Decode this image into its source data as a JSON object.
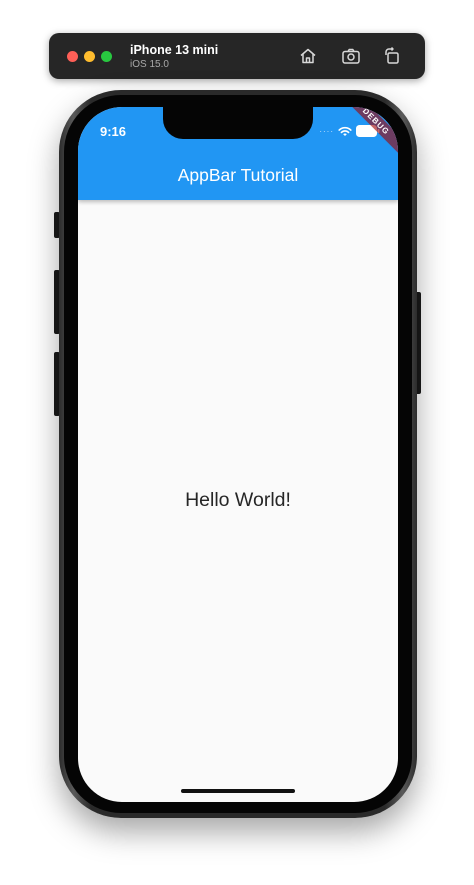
{
  "simulator": {
    "device_name": "iPhone 13 mini",
    "os_version": "iOS 15.0",
    "toolbar_icons": [
      "home-icon",
      "screenshot-icon",
      "rotate-icon"
    ]
  },
  "status_bar": {
    "time": "9:16",
    "icons": [
      "signal-dots-icon",
      "wifi-icon",
      "battery-icon"
    ]
  },
  "app_bar": {
    "title": "AppBar Tutorial",
    "color": "#2196f3"
  },
  "debug_banner": {
    "label": "DEBUG"
  },
  "body": {
    "text": "Hello World!",
    "background": "#fafafa"
  }
}
